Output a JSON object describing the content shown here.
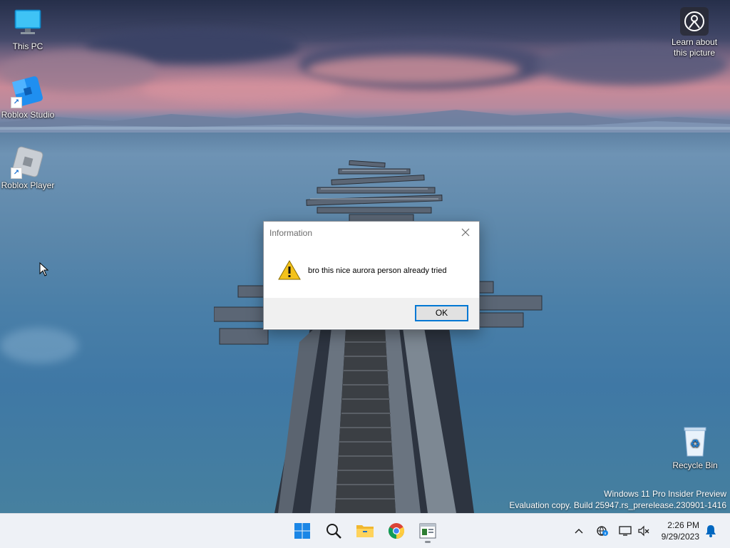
{
  "desktop": {
    "icons": [
      {
        "label": "This PC",
        "icon": "monitor-icon"
      },
      {
        "label": "Roblox Studio",
        "icon": "roblox-studio-icon"
      },
      {
        "label": "Roblox Player",
        "icon": "roblox-player-icon"
      },
      {
        "label": "Recycle Bin",
        "icon": "recycle-bin-icon"
      }
    ],
    "learn_about": {
      "line1": "Learn about",
      "line2": "this picture",
      "icon": "camera-location-icon"
    },
    "watermark": {
      "line1": "Windows 11 Pro Insider Preview",
      "line2": "Evaluation copy. Build 25947.rs_prerelease.230901-1416"
    }
  },
  "dialog": {
    "title": "Information",
    "message": "bro this nice aurora person already tried",
    "ok_label": "OK",
    "icon": "warning-icon"
  },
  "taskbar": {
    "apps": [
      "start-icon",
      "search-icon",
      "file-explorer-icon",
      "chrome-icon",
      "dialog-app-icon"
    ],
    "tray_icons": [
      "chevron-up-icon",
      "network-info-icon",
      "display-icon",
      "volume-muted-icon",
      "notification-bell-icon"
    ],
    "time": "2:26 PM",
    "date": "9/29/2023"
  },
  "colors": {
    "accent": "#0078d4",
    "taskbar_bg": "#eef1f6",
    "warning": "#f4c21b"
  }
}
